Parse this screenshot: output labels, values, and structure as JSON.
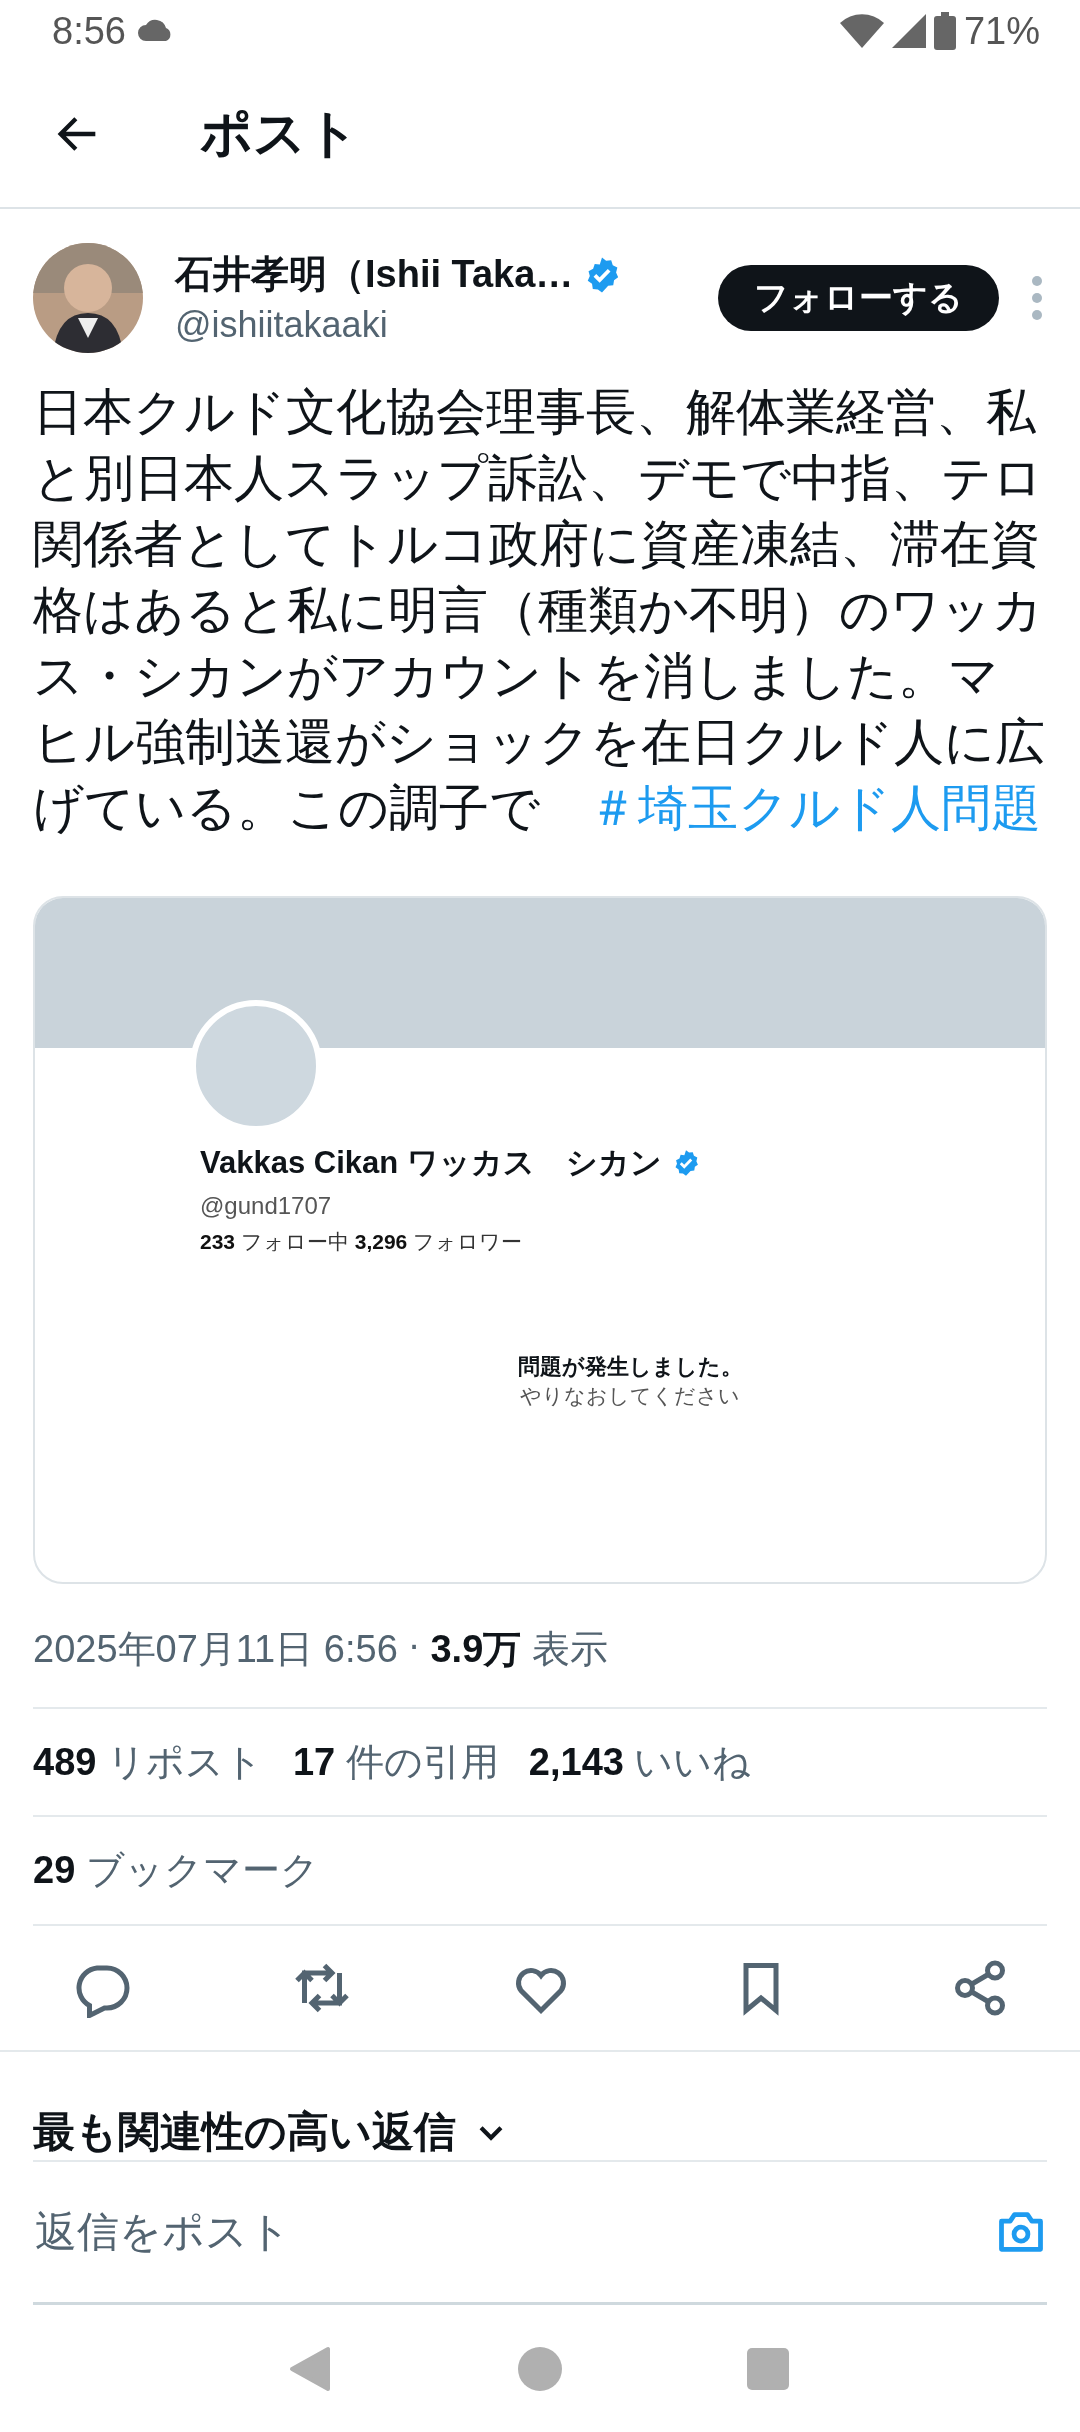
{
  "status_bar": {
    "time": "8:56",
    "battery": "71%"
  },
  "header": {
    "title": "ポスト"
  },
  "post": {
    "author": {
      "name": "石井孝明（Ishii Taka…",
      "verified": true,
      "handle": "@ishiitakaaki"
    },
    "follow_button": "フォローする",
    "body": "日本クルド文化協会理事長、解体業経営、私と別日本人スラップ訴訟、デモで中指、テロ関係者としてトルコ政府に資産凍結、滞在資格はあると私に明言（種類か不明）のワッカス・シカンがアカウントを消しました。マヒル強制送還がショックを在日クルド人に広げている。この調子で",
    "hashtag": "＃埼玉クルド人問題",
    "embedded_screenshot": {
      "name": "Vakkas Cikan ワッカス　シカン",
      "verified": true,
      "handle": "@gund1707",
      "following_count": "233",
      "following_label": "フォロー中",
      "followers_count": "3,296",
      "followers_label": "フォロワー",
      "error_title": "問題が発生しました。",
      "error_hint": "やりなおしてください"
    },
    "timestamp": "2025年07月11日 6:56",
    "separator": "·",
    "views_count": "3.9万",
    "views_label": "表示",
    "stats": [
      {
        "count": "489",
        "label": "リポスト"
      },
      {
        "count": "17",
        "label": "件の引用"
      },
      {
        "count": "2,143",
        "label": "いいね"
      }
    ],
    "bookmarks": {
      "count": "29",
      "label": "ブックマーク"
    }
  },
  "sort": {
    "label": "最も関連性の高い返信"
  },
  "reply": {
    "placeholder": "返信をポスト"
  }
}
